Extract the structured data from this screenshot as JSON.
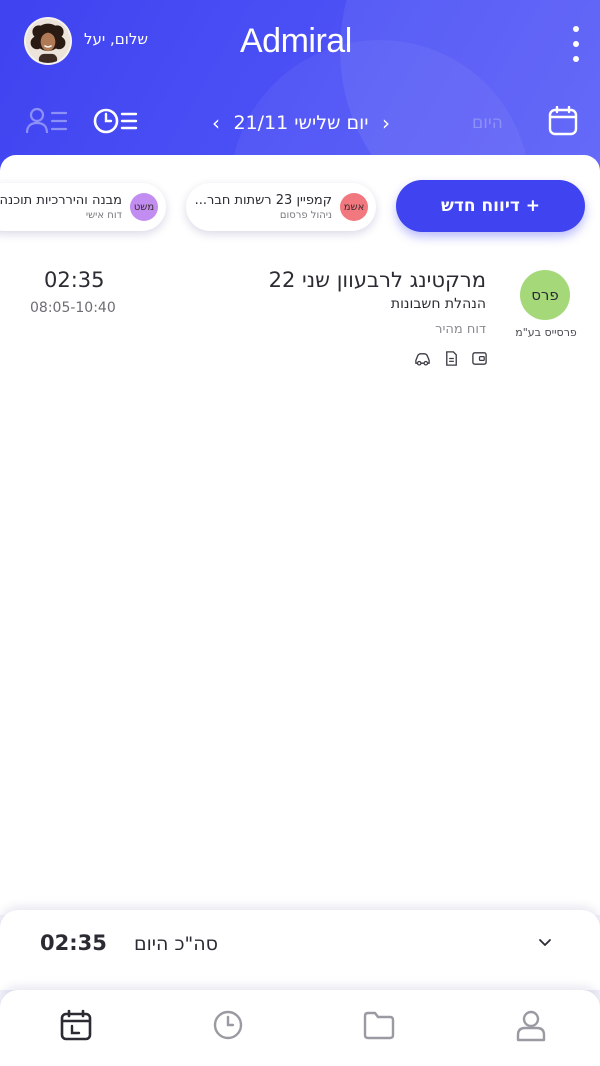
{
  "header": {
    "greeting": "שלום, יעל",
    "logo_text": "Admiral",
    "menu_icon": "kebab-menu-icon",
    "avatar_icon": "user-avatar",
    "date_label": "יום שלישי 21/11",
    "prev_arrow": "‹",
    "next_arrow": "›",
    "today_label": "היום",
    "colors": {
      "primary": "#3f43f0",
      "today_muted": "#8d90f7"
    }
  },
  "actions": {
    "new_report_label": "+ דיווח חדש"
  },
  "recent_chips": [
    {
      "badge": "אשמ",
      "badge_color": "#f2787f",
      "title": "קמפיין 23 רשתות חבר...",
      "subtitle": "ניהול פרסום"
    },
    {
      "badge": "משט",
      "badge_color": "#c28df0",
      "title": "מבנה והיררכיות תוכנה",
      "subtitle": "דוח אישי"
    }
  ],
  "report": {
    "client_badge": "פרס",
    "client_badge_color": "#a5d879",
    "client_name": "פרסייס בע\"מ",
    "title": "מרקטינג לרבעוון שני 22",
    "subtitle": "הנהלת חשבונות",
    "type": "דוח מהיר",
    "duration": "02:35",
    "time_range": "08:05-10:40",
    "icons": [
      "wallet-icon",
      "document-icon",
      "car-icon"
    ]
  },
  "total": {
    "label": "סה\"כ היום",
    "value": "02:35"
  },
  "bottom_nav": [
    "calendar-icon",
    "clock-icon",
    "folder-icon",
    "user-icon"
  ]
}
